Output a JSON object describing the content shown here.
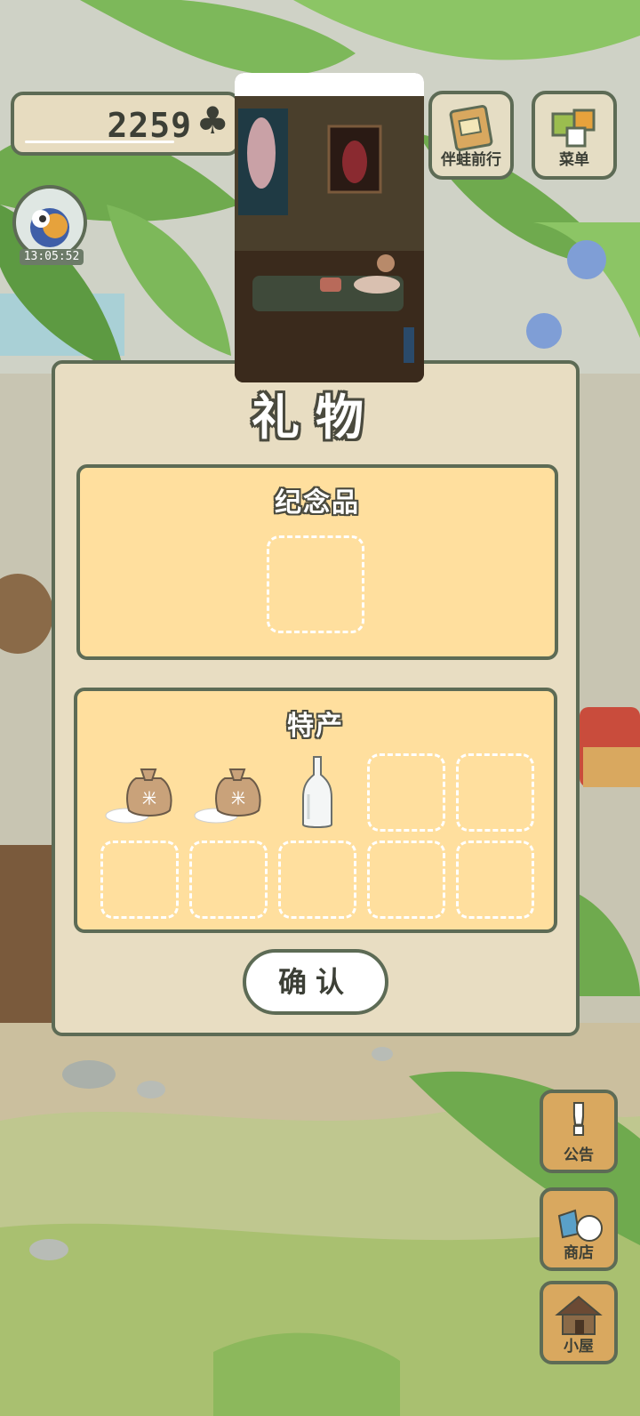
{
  "hud": {
    "clover_count": "2259",
    "clover_symbol": "♣",
    "frog_timer": "13:05:52"
  },
  "top_buttons": {
    "travel_label": "伴蛙前行",
    "menu_label": "菜单"
  },
  "gift_panel": {
    "title": "礼物",
    "souvenir_section": "纪念品",
    "specialty_section": "特产",
    "specialty_items": [
      {
        "icon": "rice-bag-icon",
        "glyph": "米"
      },
      {
        "icon": "rice-bag-icon",
        "glyph": "米"
      },
      {
        "icon": "glass-bottle-icon"
      }
    ],
    "empty_specialty_slots": 7,
    "confirm_label": "确认"
  },
  "side_buttons": {
    "notice_label": "公告",
    "notice_glyph": "!",
    "shop_label": "商店",
    "house_label": "小屋"
  },
  "colors": {
    "outline": "#5d6b55",
    "panel_bg": "#e8ddc2",
    "section_bg": "#ffdf9e",
    "leaf_green": "#6faa4e",
    "wood": "#d9a85f"
  }
}
